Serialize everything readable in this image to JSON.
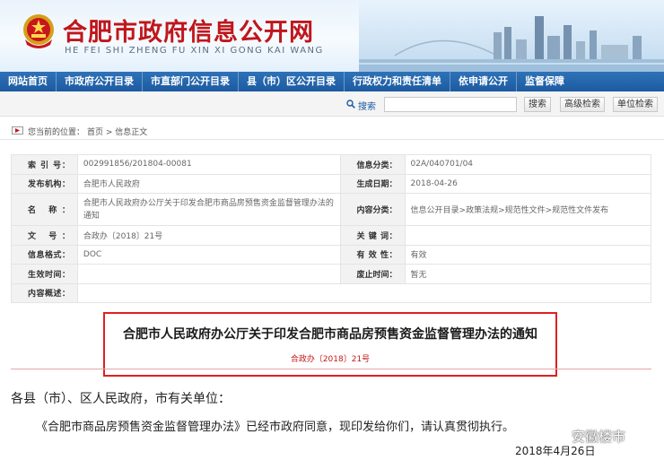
{
  "header": {
    "title": "合肥市政府信息公开网",
    "subtitle": "HE FEI SHI ZHENG FU XIN XI GONG KAI WANG"
  },
  "nav": {
    "items": [
      "网站首页",
      "市政府公开目录",
      "市直部门公开目录",
      "县（市）区公开目录",
      "行政权力和责任清单",
      "依申请公开",
      "监督保障"
    ]
  },
  "search": {
    "label": "搜索",
    "placeholder": "",
    "buttons": [
      "搜索",
      "高级检索",
      "单位检索"
    ]
  },
  "breadcrumb": {
    "prefix": "您当前的位置：",
    "path": "首页 > 信息正文"
  },
  "info_table": {
    "rows": [
      {
        "k1": "索 引 号：",
        "v1": "002991856/201804-00081",
        "k2": "信息分类：",
        "v2": "02A/040701/04"
      },
      {
        "k1": "发布机构：",
        "v1": "合肥市人民政府",
        "k2": "生成日期：",
        "v2": "2018-04-26"
      },
      {
        "k1": "名 称：",
        "v1": "合肥市人民政府办公厅关于印发合肥市商品房预售资金监督管理办法的通知",
        "k2": "内容分类：",
        "v2": "信息公开目录>政策法规>规范性文件>规范性文件发布"
      },
      {
        "k1": "文 号：",
        "v1": "合政办〔2018〕21号",
        "k2": "关 键 词：",
        "v2": ""
      },
      {
        "k1": "信息格式：",
        "v1": "DOC",
        "k2": "有 效 性：",
        "v2": "有效"
      },
      {
        "k1": "生效时间：",
        "v1": "",
        "k2": "废止时间：",
        "v2": "暂无"
      },
      {
        "k1": "内容概述：",
        "v1": ""
      }
    ]
  },
  "document": {
    "title": "合肥市人民政府办公厅关于印发合肥市商品房预售资金监督管理办法的通知",
    "number": "合政办〔2018〕21号",
    "salutation": "各县（市）、区人民政府，市有关单位：",
    "para1": "《合肥市商品房预售资金监督管理办法》已经市政府同意，现印发给你们，请认真贯彻执行。",
    "date": "2018年4月26日"
  },
  "watermark": {
    "text": "安徽楼市"
  },
  "colors": {
    "title_red": "#c0161b",
    "nav_blue": "#1c5aa0",
    "highlight_red": "#e02020"
  }
}
